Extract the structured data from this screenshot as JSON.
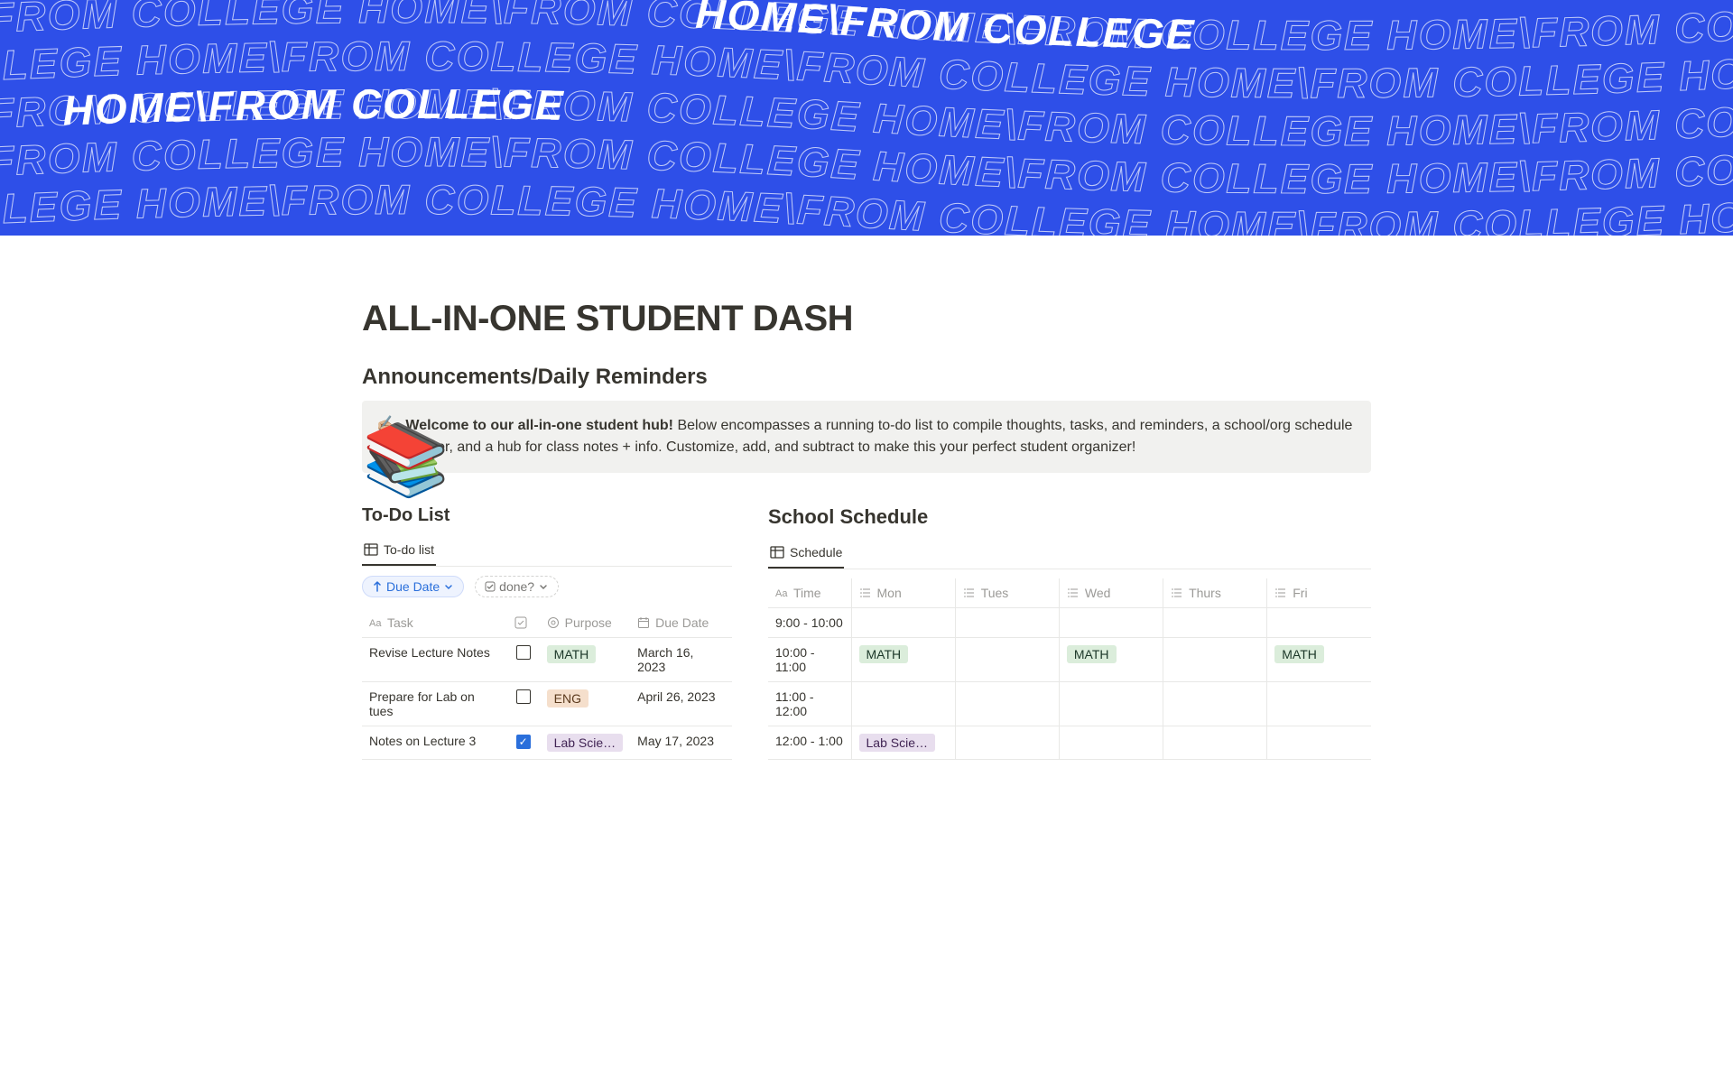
{
  "cover": {
    "repeat_text": "HOME\\FROM COLLEGE"
  },
  "page": {
    "icon": "📚",
    "title": "ALL-IN-ONE STUDENT DASH"
  },
  "announcements": {
    "heading": "Announcements/Daily Reminders",
    "callout_icon": "✍🏼",
    "callout_bold": "Welcome to our all-in-one student hub!",
    "callout_rest": " Below encompasses a running to-do list to compile thoughts, tasks, and reminders, a school/org schedule tracker, and a hub for class notes + info. Customize, add, and subtract to make this your perfect student organizer!"
  },
  "todo": {
    "heading": "To-Do List",
    "view_tab": "To-do list",
    "filters": {
      "due_date": "Due Date",
      "done": "done?"
    },
    "columns": {
      "task": "Task",
      "purpose": "Purpose",
      "due": "Due Date"
    },
    "rows": [
      {
        "task": "Revise Lecture Notes",
        "done": false,
        "purpose": "MATH",
        "purpose_tag": "tag-math",
        "due": "March 16, 2023"
      },
      {
        "task": "Prepare for Lab on tues",
        "done": false,
        "purpose": "ENG",
        "purpose_tag": "tag-eng",
        "due": "April 26, 2023"
      },
      {
        "task": "Notes on Lecture 3",
        "done": true,
        "purpose": "Lab Scie…",
        "purpose_tag": "tag-lab",
        "due": "May 17, 2023"
      }
    ]
  },
  "schedule": {
    "heading": "School Schedule",
    "view_tab": "Schedule",
    "columns": {
      "time": "Time",
      "mon": "Mon",
      "tues": "Tues",
      "wed": "Wed",
      "thurs": "Thurs",
      "fri": "Fri"
    },
    "rows": [
      {
        "time": "9:00 - 10:00",
        "mon": "",
        "tues": "",
        "wed": "",
        "thurs": "",
        "fri": ""
      },
      {
        "time": "10:00 - 11:00",
        "mon": "MATH",
        "mon_tag": "tag-math",
        "tues": "",
        "wed": "MATH",
        "wed_tag": "tag-math",
        "thurs": "",
        "fri": "MATH",
        "fri_tag": "tag-math"
      },
      {
        "time": "11:00 - 12:00",
        "mon": "",
        "tues": "",
        "wed": "",
        "thurs": "",
        "fri": ""
      },
      {
        "time": "12:00 - 1:00",
        "mon": "Lab Scie…",
        "mon_tag": "tag-lab",
        "tues": "",
        "wed": "",
        "thurs": "",
        "fri": ""
      }
    ]
  }
}
